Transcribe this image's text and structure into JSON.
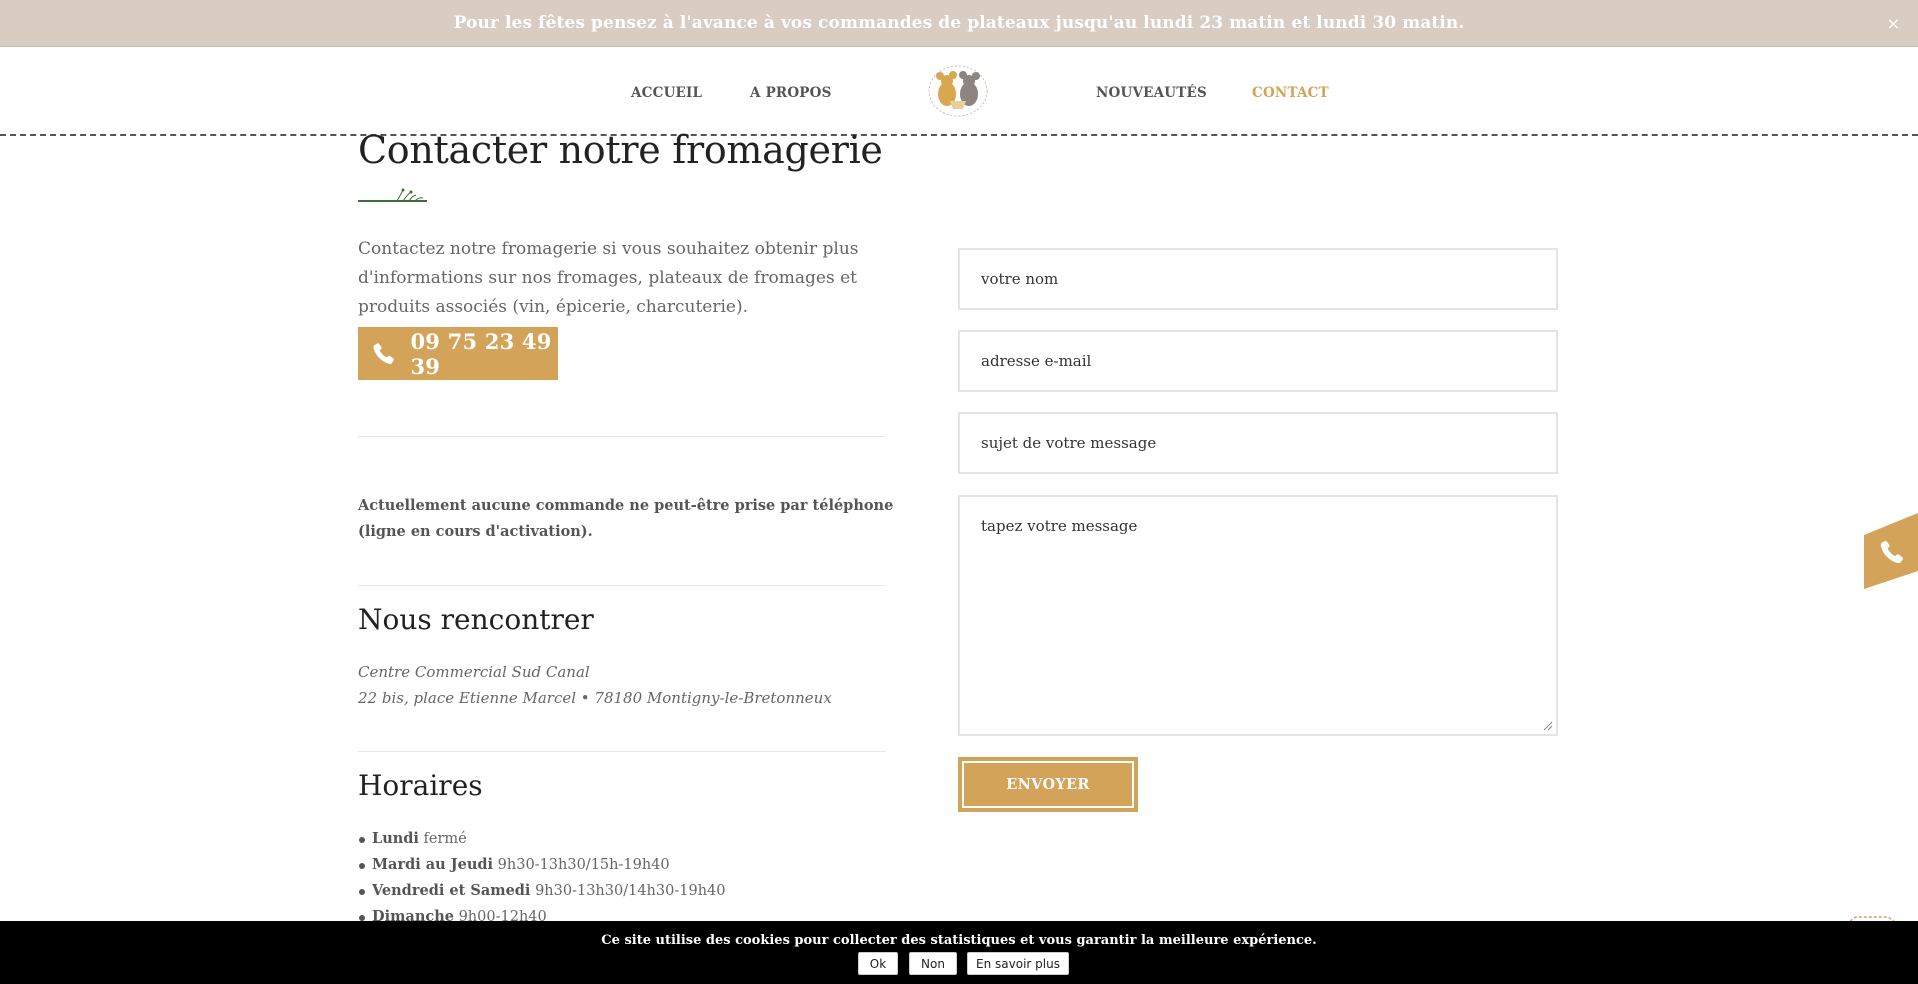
{
  "announcement": {
    "text": "Pour les fêtes pensez à l'avance à vos commandes de plateaux jusqu'au lundi 23 matin et lundi 30 matin.",
    "close_label": "×"
  },
  "nav": {
    "items": [
      {
        "label": "ACCUEIL"
      },
      {
        "label": "A PROPOS"
      },
      {
        "label": "NOUVEAUTÉS"
      },
      {
        "label": "CONTACT",
        "active": true
      }
    ],
    "logo_icon": "cheese-mice-logo"
  },
  "contact": {
    "title": "Contacter notre fromagerie",
    "intro": "Contactez notre fromagerie si vous souhaitez obtenir plus d'informations sur nos fromages, plateaux de fromages et produits associés (vin, épicerie, charcuterie).",
    "phone": "09 75 23 49 39",
    "phone_icon": "phone-icon",
    "notice": "Actuellement aucune commande ne peut-être prise par téléphone (ligne en cours d'activation)."
  },
  "meet": {
    "title": "Nous rencontrer",
    "address_line1": "Centre Commercial Sud Canal",
    "address_line2": "22 bis, place Etienne Marcel • 78180 Montigny-le-Bretonneux"
  },
  "hours": {
    "title": "Horaires",
    "items": [
      {
        "day": "Lundi",
        "time": "fermé"
      },
      {
        "day": "Mardi au Jeudi",
        "time": "9h30-13h30/15h-19h40"
      },
      {
        "day": "Vendredi et Samedi",
        "time": "9h30-13h30/14h30-19h40"
      },
      {
        "day": "Dimanche",
        "time": "9h00-12h40"
      }
    ]
  },
  "form": {
    "name_placeholder": "votre nom",
    "email_placeholder": "adresse e-mail",
    "subject_placeholder": "sujet de votre message",
    "message_placeholder": "tapez votre message",
    "submit_label": "ENVOYER"
  },
  "cookie": {
    "text": "Ce site utilise des cookies pour collecter des statistiques et vous garantir la meilleure expérience.",
    "ok_label": "Ok",
    "no_label": "Non",
    "more_label": "En savoir plus"
  },
  "colors": {
    "accent": "#d4a35a",
    "announce_bg": "#d9ccc2",
    "text": "#555555"
  }
}
